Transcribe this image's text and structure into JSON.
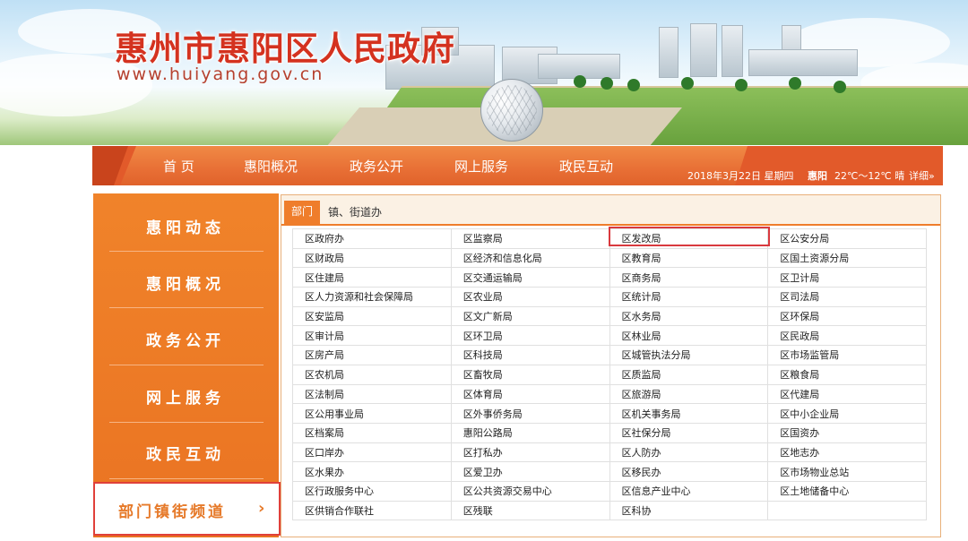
{
  "site": {
    "title": "惠州市惠阳区人民政府",
    "url": "www.huiyang.gov.cn"
  },
  "nav": {
    "items": [
      "首 页",
      "惠阳概况",
      "政务公开",
      "网上服务",
      "政民互动"
    ],
    "date": "2018年3月22日 星期四",
    "city": "惠阳",
    "weather": "22℃～12℃ 晴",
    "details": "详细»"
  },
  "left_menu": {
    "items": [
      "惠阳动态",
      "惠阳概况",
      "政务公开",
      "网上服务",
      "政民互动"
    ],
    "channel": "部门镇街频道",
    "channel_arrow": "›"
  },
  "tabs": [
    "部门",
    "镇、街道办"
  ],
  "departments": [
    [
      "区政府办",
      "区监察局",
      "区发改局",
      "区公安分局"
    ],
    [
      "区财政局",
      "区经济和信息化局",
      "区教育局",
      "区国土资源分局"
    ],
    [
      "区住建局",
      "区交通运输局",
      "区商务局",
      "区卫计局"
    ],
    [
      "区人力资源和社会保障局",
      "区农业局",
      "区统计局",
      "区司法局"
    ],
    [
      "区安监局",
      "区文广新局",
      "区水务局",
      "区环保局"
    ],
    [
      "区审计局",
      "区环卫局",
      "区林业局",
      "区民政局"
    ],
    [
      "区房产局",
      "区科技局",
      "区城管执法分局",
      "区市场监管局"
    ],
    [
      "区农机局",
      "区畜牧局",
      "区质监局",
      "区粮食局"
    ],
    [
      "区法制局",
      "区体育局",
      "区旅游局",
      "区代建局"
    ],
    [
      "区公用事业局",
      "区外事侨务局",
      "区机关事务局",
      "区中小企业局"
    ],
    [
      "区档案局",
      "惠阳公路局",
      "区社保分局",
      "区国资办"
    ],
    [
      "区口岸办",
      "区打私办",
      "区人防办",
      "区地志办"
    ],
    [
      "区水果办",
      "区爱卫办",
      "区移民办",
      "区市场物业总站"
    ],
    [
      "区行政服务中心",
      "区公共资源交易中心",
      "区信息产业中心",
      "区土地储备中心"
    ],
    [
      "区供销合作联社",
      "区残联",
      "区科协",
      ""
    ]
  ],
  "colors": {
    "title_red": "#d4321f",
    "nav_orange": "#e86f35",
    "menu_orange": "#ea7322",
    "highlight_red": "#d9393e"
  }
}
